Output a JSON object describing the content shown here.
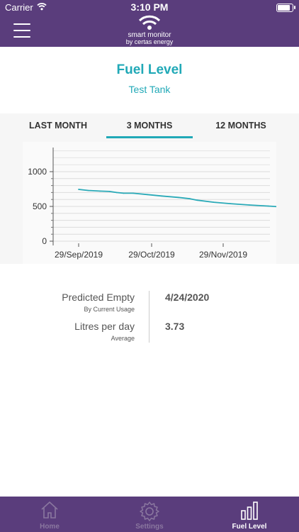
{
  "status_bar": {
    "carrier": "Carrier",
    "time": "3:10 PM"
  },
  "header": {
    "logo_line1": "smart monitor",
    "logo_line2": "by certas energy"
  },
  "page": {
    "title": "Fuel Level",
    "subtitle": "Test Tank"
  },
  "tabs": [
    {
      "label": "LAST MONTH",
      "selected": false
    },
    {
      "label": "3 MONTHS",
      "selected": true
    },
    {
      "label": "12 MONTHS",
      "selected": false
    }
  ],
  "chart_data": {
    "type": "line",
    "title": "",
    "xlabel": "",
    "ylabel": "",
    "ylim": [
      0,
      1000
    ],
    "yticks": [
      0,
      500,
      1000
    ],
    "xticks": [
      "29/Sep/2019",
      "29/Oct/2019",
      "29/Nov/2019"
    ],
    "x_dates": [
      "2019-09-29",
      "2019-10-03",
      "2019-10-08",
      "2019-10-12",
      "2019-10-15",
      "2019-10-18",
      "2019-10-22",
      "2019-10-28",
      "2019-11-03",
      "2019-11-10",
      "2019-11-15",
      "2019-11-18",
      "2019-11-25",
      "2019-12-02",
      "2019-12-10",
      "2019-12-18",
      "2019-12-25"
    ],
    "series": [
      {
        "values": [
          745,
          730,
          720,
          715,
          700,
          690,
          690,
          670,
          650,
          630,
          610,
          590,
          560,
          540,
          520,
          505,
          490
        ]
      }
    ],
    "line_color": "#2aaab8",
    "grid": true
  },
  "stats": {
    "predicted_empty_label": "Predicted Empty",
    "predicted_empty_sub": "By Current Usage",
    "predicted_empty_value": "4/24/2020",
    "litres_label": "Litres per day",
    "litres_sub": "Average",
    "litres_value": "3.73"
  },
  "bottom_nav": [
    {
      "label": "Home",
      "icon": "home-icon",
      "active": false
    },
    {
      "label": "Settings",
      "icon": "gear-icon",
      "active": false
    },
    {
      "label": "Fuel Level",
      "icon": "bar-chart-icon",
      "active": true
    }
  ],
  "colors": {
    "brand_purple": "#5a3d7c",
    "accent_teal": "#21a9b7"
  }
}
